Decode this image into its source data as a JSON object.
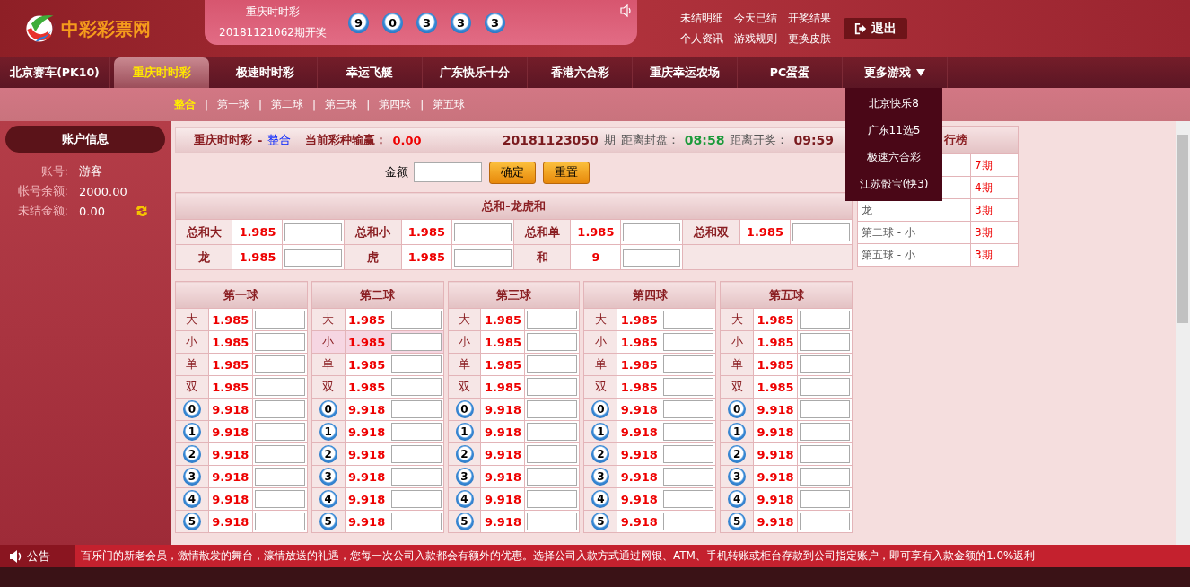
{
  "logo": {
    "text": "中彩彩票网"
  },
  "draw": {
    "game": "重庆时时彩",
    "issue": "20181121062期开奖",
    "numbers": [
      "9",
      "0",
      "3",
      "3",
      "3"
    ]
  },
  "top_links": [
    "未结明细",
    "今天已结",
    "开奖结果",
    "个人资讯",
    "游戏规则",
    "更换皮肤"
  ],
  "logout": "退出",
  "nav": [
    {
      "label": "北京赛车(PK10)",
      "selected": false,
      "kind": "link"
    },
    {
      "label": "重庆时时彩",
      "selected": true,
      "kind": "link"
    },
    {
      "label": "极速时时彩",
      "selected": false,
      "kind": "link"
    },
    {
      "label": "幸运飞艇",
      "selected": false,
      "kind": "link"
    },
    {
      "label": "广东快乐十分",
      "selected": false,
      "kind": "link"
    },
    {
      "label": "香港六合彩",
      "selected": false,
      "kind": "link"
    },
    {
      "label": "重庆幸运农场",
      "selected": false,
      "kind": "link"
    },
    {
      "label": "PC蛋蛋",
      "selected": false,
      "kind": "link"
    },
    {
      "label": "更多游戏",
      "selected": false,
      "kind": "menu"
    }
  ],
  "more_menu": [
    "北京快乐8",
    "广东11选5",
    "极速六合彩",
    "江苏骰宝(快3)"
  ],
  "subnav": [
    {
      "label": "整合",
      "selected": true
    },
    {
      "sep": "|",
      "label": "第一球",
      "selected": false
    },
    {
      "sep": "|",
      "label": "第二球",
      "selected": false
    },
    {
      "sep": "|",
      "label": "第三球",
      "selected": false
    },
    {
      "sep": "|",
      "label": "第四球",
      "selected": false
    },
    {
      "sep": "|",
      "label": "第五球",
      "selected": false
    }
  ],
  "account": {
    "title": "账户信息",
    "fields": [
      {
        "label": "账号:",
        "value": "游客",
        "refresh": false
      },
      {
        "label": "帐号余额:",
        "value": "2000.00",
        "refresh": false
      },
      {
        "label": "未结金额:",
        "value": "0.00",
        "refresh": true
      }
    ]
  },
  "panel": {
    "game": "重庆时时彩",
    "separator": "-",
    "mode": "整合",
    "pl_label": "当前彩种输赢：",
    "pl_value": "0.00",
    "issue": "20181123050",
    "issue_suffix": "期",
    "close_label": "距离封盘：",
    "close_time": "08:58",
    "draw_label": "距离开奖：",
    "draw_time": "09:59"
  },
  "amount": {
    "label": "金额",
    "buttons": [
      "确定",
      "重置"
    ]
  },
  "sum_table": {
    "title": "总和-龙虎和",
    "rows": [
      [
        {
          "label": "总和大",
          "odds": "1.985"
        },
        {
          "label": "总和小",
          "odds": "1.985"
        },
        {
          "label": "总和单",
          "odds": "1.985"
        },
        {
          "label": "总和双",
          "odds": "1.985"
        }
      ],
      [
        {
          "label": "龙",
          "odds": "1.985"
        },
        {
          "label": "虎",
          "odds": "1.985"
        },
        {
          "label": "和",
          "odds": "9"
        }
      ]
    ]
  },
  "balls": [
    {
      "title": "第一球",
      "rows": [
        {
          "kind": "text",
          "label": "大",
          "odds": "1.985",
          "highlighted": false
        },
        {
          "kind": "text",
          "label": "小",
          "odds": "1.985",
          "highlighted": false
        },
        {
          "kind": "text",
          "label": "单",
          "odds": "1.985",
          "highlighted": false
        },
        {
          "kind": "text",
          "label": "双",
          "odds": "1.985",
          "highlighted": false
        },
        {
          "kind": "ball",
          "label": "0",
          "odds": "9.918",
          "highlighted": false
        },
        {
          "kind": "ball",
          "label": "1",
          "odds": "9.918",
          "highlighted": false
        },
        {
          "kind": "ball",
          "label": "2",
          "odds": "9.918",
          "highlighted": false
        },
        {
          "kind": "ball",
          "label": "3",
          "odds": "9.918",
          "highlighted": false
        },
        {
          "kind": "ball",
          "label": "4",
          "odds": "9.918",
          "highlighted": false
        },
        {
          "kind": "ball",
          "label": "5",
          "odds": "9.918",
          "highlighted": false
        }
      ]
    },
    {
      "title": "第二球",
      "rows": [
        {
          "kind": "text",
          "label": "大",
          "odds": "1.985",
          "highlighted": false
        },
        {
          "kind": "text",
          "label": "小",
          "odds": "1.985",
          "highlighted": true
        },
        {
          "kind": "text",
          "label": "单",
          "odds": "1.985",
          "highlighted": false
        },
        {
          "kind": "text",
          "label": "双",
          "odds": "1.985",
          "highlighted": false
        },
        {
          "kind": "ball",
          "label": "0",
          "odds": "9.918",
          "highlighted": false
        },
        {
          "kind": "ball",
          "label": "1",
          "odds": "9.918",
          "highlighted": false
        },
        {
          "kind": "ball",
          "label": "2",
          "odds": "9.918",
          "highlighted": false
        },
        {
          "kind": "ball",
          "label": "3",
          "odds": "9.918",
          "highlighted": false
        },
        {
          "kind": "ball",
          "label": "4",
          "odds": "9.918",
          "highlighted": false
        },
        {
          "kind": "ball",
          "label": "5",
          "odds": "9.918",
          "highlighted": false
        }
      ]
    },
    {
      "title": "第三球",
      "rows": [
        {
          "kind": "text",
          "label": "大",
          "odds": "1.985",
          "highlighted": false
        },
        {
          "kind": "text",
          "label": "小",
          "odds": "1.985",
          "highlighted": false
        },
        {
          "kind": "text",
          "label": "单",
          "odds": "1.985",
          "highlighted": false
        },
        {
          "kind": "text",
          "label": "双",
          "odds": "1.985",
          "highlighted": false
        },
        {
          "kind": "ball",
          "label": "0",
          "odds": "9.918",
          "highlighted": false
        },
        {
          "kind": "ball",
          "label": "1",
          "odds": "9.918",
          "highlighted": false
        },
        {
          "kind": "ball",
          "label": "2",
          "odds": "9.918",
          "highlighted": false
        },
        {
          "kind": "ball",
          "label": "3",
          "odds": "9.918",
          "highlighted": false
        },
        {
          "kind": "ball",
          "label": "4",
          "odds": "9.918",
          "highlighted": false
        },
        {
          "kind": "ball",
          "label": "5",
          "odds": "9.918",
          "highlighted": false
        }
      ]
    },
    {
      "title": "第四球",
      "rows": [
        {
          "kind": "text",
          "label": "大",
          "odds": "1.985",
          "highlighted": false
        },
        {
          "kind": "text",
          "label": "小",
          "odds": "1.985",
          "highlighted": false
        },
        {
          "kind": "text",
          "label": "单",
          "odds": "1.985",
          "highlighted": false
        },
        {
          "kind": "text",
          "label": "双",
          "odds": "1.985",
          "highlighted": false
        },
        {
          "kind": "ball",
          "label": "0",
          "odds": "9.918",
          "highlighted": false
        },
        {
          "kind": "ball",
          "label": "1",
          "odds": "9.918",
          "highlighted": false
        },
        {
          "kind": "ball",
          "label": "2",
          "odds": "9.918",
          "highlighted": false
        },
        {
          "kind": "ball",
          "label": "3",
          "odds": "9.918",
          "highlighted": false
        },
        {
          "kind": "ball",
          "label": "4",
          "odds": "9.918",
          "highlighted": false
        },
        {
          "kind": "ball",
          "label": "5",
          "odds": "9.918",
          "highlighted": false
        }
      ]
    },
    {
      "title": "第五球",
      "rows": [
        {
          "kind": "text",
          "label": "大",
          "odds": "1.985",
          "highlighted": false
        },
        {
          "kind": "text",
          "label": "小",
          "odds": "1.985",
          "highlighted": false
        },
        {
          "kind": "text",
          "label": "单",
          "odds": "1.985",
          "highlighted": false
        },
        {
          "kind": "text",
          "label": "双",
          "odds": "1.985",
          "highlighted": false
        },
        {
          "kind": "ball",
          "label": "0",
          "odds": "9.918",
          "highlighted": false
        },
        {
          "kind": "ball",
          "label": "1",
          "odds": "9.918",
          "highlighted": false
        },
        {
          "kind": "ball",
          "label": "2",
          "odds": "9.918",
          "highlighted": false
        },
        {
          "kind": "ball",
          "label": "3",
          "odds": "9.918",
          "highlighted": false
        },
        {
          "kind": "ball",
          "label": "4",
          "odds": "9.918",
          "highlighted": false
        },
        {
          "kind": "ball",
          "label": "5",
          "odds": "9.918",
          "highlighted": false
        }
      ]
    }
  ],
  "ranking": {
    "title": "行榜",
    "rows": [
      {
        "count": "7期"
      },
      {
        "count": "4期"
      },
      {
        "label": "龙",
        "count": "3期"
      },
      {
        "label": "第二球 - 小",
        "count": "3期"
      },
      {
        "label": "第五球 - 小",
        "count": "3期"
      }
    ]
  },
  "notice": {
    "label": "公告",
    "text": "百乐门的新老会员，激情散发的舞台，濠情放送的礼遇，您每一次公司入款都会有额外的优惠。选择公司入款方式通过网银、ATM、手机转账或柜台存款到公司指定账户，即可享有入款金额的1.0%返利"
  }
}
